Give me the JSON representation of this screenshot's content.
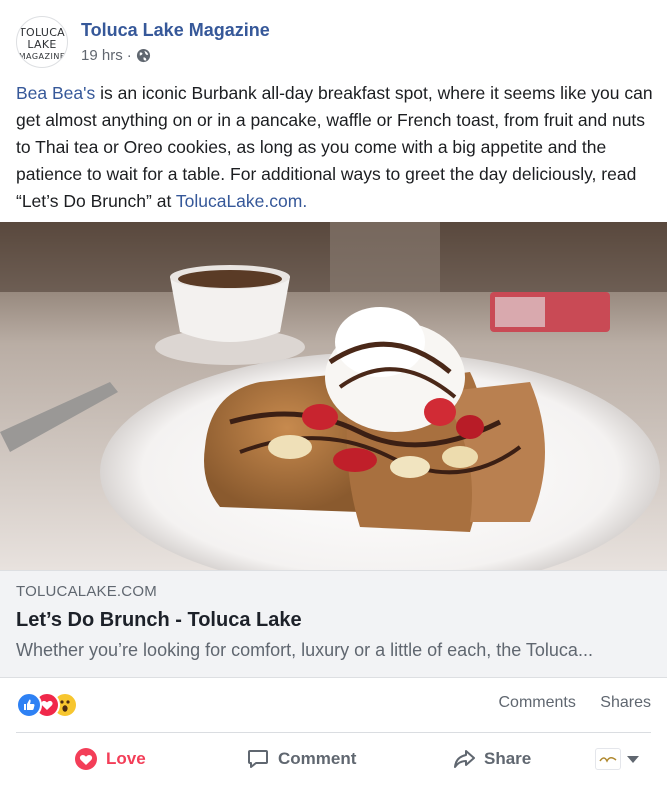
{
  "post": {
    "page_name": "Toluca Lake Magazine",
    "time": "19 hrs",
    "separator": "·",
    "avatar": {
      "line1": "TOLUCA",
      "line2": "LAKE",
      "line3": "MAGAZINE"
    },
    "body": {
      "lead_link": "Bea Bea's",
      "text": " is an iconic Burbank all-day breakfast spot, where it seems like you can get almost anything on or in a pancake, waffle or French toast, from fruit and nuts to Thai tea or Oreo cookies, as long as you come with a big appetite and the patience to wait for a table. For additional ways to greet the day deliciously, read “Let’s Do Brunch” at ",
      "tail_link": "TolucaLake.com."
    }
  },
  "preview": {
    "domain": "TOLUCALAKE.COM",
    "title": "Let’s Do Brunch - Toluca Lake",
    "description": "Whether you’re looking for comfort, luxury or a little of each, the Toluca..."
  },
  "reactions": {
    "icons": [
      "like-icon",
      "love-icon",
      "wow-icon"
    ],
    "comments_label": "Comments",
    "shares_label": "Shares"
  },
  "actions": {
    "love_label": "Love",
    "comment_label": "Comment",
    "share_label": "Share"
  },
  "colors": {
    "link": "#365899",
    "love": "#f33e58",
    "like": "#2e81f4",
    "wow": "#f7c62f",
    "muted": "#606770"
  }
}
